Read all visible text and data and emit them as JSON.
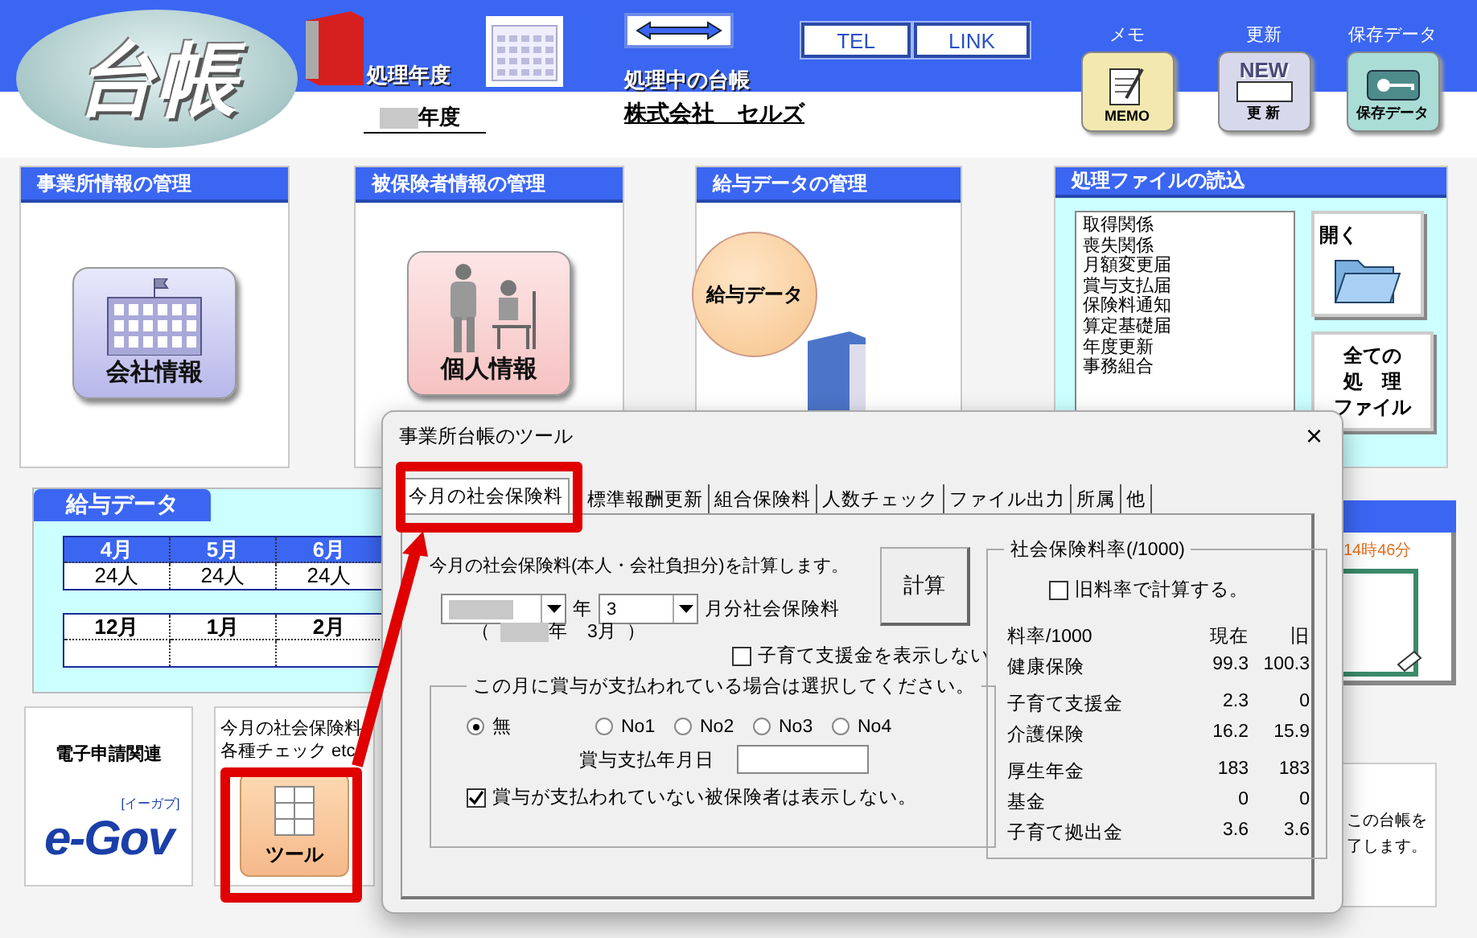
{
  "header": {
    "logo": "台帳",
    "year_label": "処理年度",
    "current_label": "処理中の台帳",
    "year_redacted": true,
    "year_suffix": "年度",
    "company": "株式会社　セルズ",
    "buttons": [
      {
        "label": "TEL"
      },
      {
        "label": "LINK"
      }
    ],
    "tools": [
      {
        "label": "メモ",
        "kind": "memo",
        "icon_text": "MEMO"
      },
      {
        "label": "更新",
        "kind": "update",
        "icon_text": "更 新",
        "badge": "NEW"
      },
      {
        "label": "保存データ",
        "kind": "save",
        "icon_text": "保存データ"
      }
    ]
  },
  "panels": [
    {
      "title": "事業所情報の管理",
      "kind": "company",
      "button": "会社情報"
    },
    {
      "title": "被保険者情報の管理",
      "kind": "person",
      "button": "個人情報"
    },
    {
      "title": "給与データの管理",
      "kind": "salary",
      "button": "給与データ"
    }
  ],
  "files": {
    "title": "処理ファイルの読込",
    "items": [
      "取得関係",
      "喪失関係",
      "月額変更届",
      "賞与支払届",
      "保険料通知",
      "算定基礎届",
      "年度更新",
      "事務組合"
    ],
    "open_label": "開く",
    "all_button": [
      "全ての",
      "処　理",
      "ファイル"
    ]
  },
  "salary_data": {
    "title": "給与データ",
    "blocks": [
      {
        "months": [
          "4月",
          "5月",
          "6月"
        ],
        "counts": [
          "24人",
          "24人",
          "24人"
        ]
      },
      {
        "months": [
          "12月",
          "1月",
          "2月"
        ]
      }
    ]
  },
  "clock": {
    "time": "14時46分"
  },
  "exit": {
    "lines": [
      "この台帳を",
      "了します。"
    ]
  },
  "egov": {
    "title": "電子申請関連",
    "logo": "e-Gov",
    "logo_sub": "[イーガブ]"
  },
  "tools_panel": {
    "lines": [
      "今月の社会保険料",
      "各種チェック etc"
    ],
    "button": "ツール"
  },
  "dialog": {
    "title": "事業所台帳のツール",
    "close": "×",
    "tabs": [
      {
        "label": "今月の社会保険料",
        "selected": true
      },
      {
        "label": "標準報酬更新",
        "selected": false
      },
      {
        "label": "組合保険料",
        "selected": false
      },
      {
        "label": "人数チェック",
        "selected": false
      },
      {
        "label": "ファイル出力",
        "selected": false
      },
      {
        "label": "所属",
        "selected": false
      },
      {
        "label": "他",
        "selected": false
      }
    ],
    "intro": "今月の社会保険料(本人・会社負担分)を計算します。",
    "year_select": {
      "redacted": true
    },
    "year_unit": "年",
    "month_select": {
      "value": "3"
    },
    "month_unit": "月分社会保険料",
    "period": {
      "open": "（",
      "redacted": true,
      "text": "年　3月",
      "close": "）"
    },
    "calc_button": "計算",
    "hide_support": {
      "label": "子育て支援金を表示しない",
      "checked": false
    },
    "bonus": {
      "title": "この月に賞与が支払われている場合は選択してください。",
      "options": [
        {
          "label": "無",
          "selected": true
        },
        {
          "label": "No1",
          "selected": false
        },
        {
          "label": "No2",
          "selected": false
        },
        {
          "label": "No3",
          "selected": false
        },
        {
          "label": "No4",
          "selected": false
        }
      ],
      "date_label": "賞与支払年月日",
      "hide_unpaid": {
        "label": "賞与が支払われていない被保険者は表示しない。",
        "checked": true
      }
    },
    "rates": {
      "title": "社会保険料率(/1000)",
      "use_old": {
        "label": "旧料率で計算する。",
        "checked": false
      },
      "columns": [
        "料率/1000",
        "現在",
        "旧"
      ],
      "rows": [
        {
          "name": "健康保険",
          "current": "99.3",
          "old": "100.3"
        },
        {
          "name": "子育て支援金",
          "current": "2.3",
          "old": "0"
        },
        {
          "name": "介護保険",
          "current": "16.2",
          "old": "15.9"
        },
        {
          "name": "厚生年金",
          "current": "183",
          "old": "183"
        },
        {
          "name": "基金",
          "current": "0",
          "old": "0"
        },
        {
          "name": "子育て拠出金",
          "current": "3.6",
          "old": "3.6"
        }
      ]
    }
  }
}
